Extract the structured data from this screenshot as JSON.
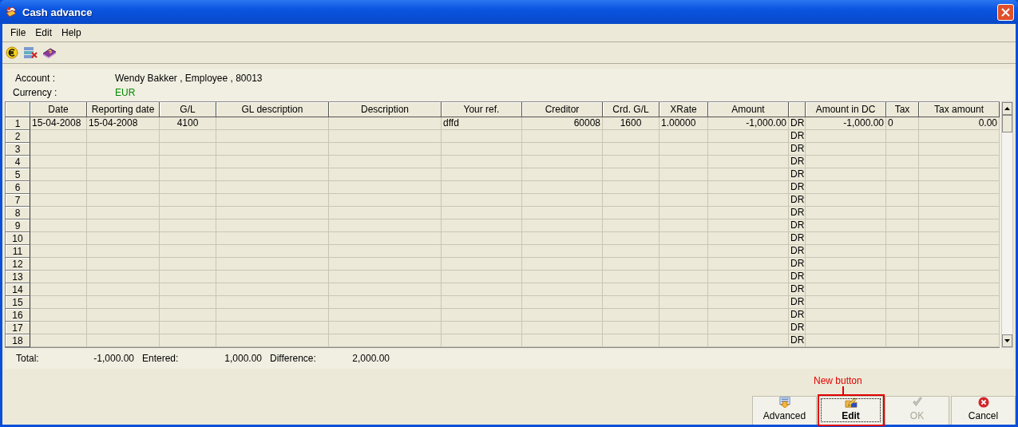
{
  "window": {
    "title": "Cash advance"
  },
  "menu": [
    "File",
    "Edit",
    "Help"
  ],
  "header": {
    "account_label": "Account :",
    "account_value": "Wendy Bakker , Employee , 80013",
    "currency_label": "Currency :",
    "currency_value": "EUR"
  },
  "table": {
    "columns": [
      "Date",
      "Reporting date",
      "G/L",
      "GL description",
      "Description",
      "Your ref.",
      "Creditor",
      "Crd. G/L",
      "XRate",
      "Amount",
      "",
      "Amount in DC",
      "Tax",
      "Tax amount"
    ],
    "rows": [
      {
        "number": "1",
        "cells": [
          "15-04-2008",
          "15-04-2008",
          "4100",
          null,
          null,
          "dffd",
          "60008",
          "1600",
          "1.00000",
          "-1,000.00",
          "DR",
          "-1,000.00",
          "0",
          "0.00"
        ]
      },
      {
        "number": "2",
        "cells": [
          null,
          null,
          null,
          null,
          null,
          null,
          null,
          null,
          null,
          null,
          "DR",
          null,
          null,
          null
        ]
      },
      {
        "number": "3",
        "cells": [
          null,
          null,
          null,
          null,
          null,
          null,
          null,
          null,
          null,
          null,
          "DR",
          null,
          null,
          null
        ]
      },
      {
        "number": "4",
        "cells": [
          null,
          null,
          null,
          null,
          null,
          null,
          null,
          null,
          null,
          null,
          "DR",
          null,
          null,
          null
        ]
      },
      {
        "number": "5",
        "cells": [
          null,
          null,
          null,
          null,
          null,
          null,
          null,
          null,
          null,
          null,
          "DR",
          null,
          null,
          null
        ]
      },
      {
        "number": "6",
        "cells": [
          null,
          null,
          null,
          null,
          null,
          null,
          null,
          null,
          null,
          null,
          "DR",
          null,
          null,
          null
        ]
      },
      {
        "number": "7",
        "cells": [
          null,
          null,
          null,
          null,
          null,
          null,
          null,
          null,
          null,
          null,
          "DR",
          null,
          null,
          null
        ]
      },
      {
        "number": "8",
        "cells": [
          null,
          null,
          null,
          null,
          null,
          null,
          null,
          null,
          null,
          null,
          "DR",
          null,
          null,
          null
        ]
      },
      {
        "number": "9",
        "cells": [
          null,
          null,
          null,
          null,
          null,
          null,
          null,
          null,
          null,
          null,
          "DR",
          null,
          null,
          null
        ]
      },
      {
        "number": "10",
        "cells": [
          null,
          null,
          null,
          null,
          null,
          null,
          null,
          null,
          null,
          null,
          "DR",
          null,
          null,
          null
        ]
      },
      {
        "number": "11",
        "cells": [
          null,
          null,
          null,
          null,
          null,
          null,
          null,
          null,
          null,
          null,
          "DR",
          null,
          null,
          null
        ]
      },
      {
        "number": "12",
        "cells": [
          null,
          null,
          null,
          null,
          null,
          null,
          null,
          null,
          null,
          null,
          "DR",
          null,
          null,
          null
        ]
      },
      {
        "number": "13",
        "cells": [
          null,
          null,
          null,
          null,
          null,
          null,
          null,
          null,
          null,
          null,
          "DR",
          null,
          null,
          null
        ]
      },
      {
        "number": "14",
        "cells": [
          null,
          null,
          null,
          null,
          null,
          null,
          null,
          null,
          null,
          null,
          "DR",
          null,
          null,
          null
        ]
      },
      {
        "number": "15",
        "cells": [
          null,
          null,
          null,
          null,
          null,
          null,
          null,
          null,
          null,
          null,
          "DR",
          null,
          null,
          null
        ]
      },
      {
        "number": "16",
        "cells": [
          null,
          null,
          null,
          null,
          null,
          null,
          null,
          null,
          null,
          null,
          "DR",
          null,
          null,
          null
        ]
      },
      {
        "number": "17",
        "cells": [
          null,
          null,
          null,
          null,
          null,
          null,
          null,
          null,
          null,
          null,
          "DR",
          null,
          null,
          null
        ]
      },
      {
        "number": "18",
        "cells": [
          null,
          null,
          null,
          null,
          null,
          null,
          null,
          null,
          null,
          null,
          "DR",
          null,
          null,
          null
        ]
      }
    ]
  },
  "totals": [
    {
      "label": "Total:",
      "value": "-1,000.00"
    },
    {
      "label": "Entered:",
      "value": "1,000.00"
    },
    {
      "label": "Difference:",
      "value": "2,000.00"
    }
  ],
  "buttons": [
    {
      "kind": "advanced",
      "label": "Advanced",
      "disabled": false,
      "focused": false
    },
    {
      "kind": "edit",
      "label": "Edit",
      "disabled": false,
      "focused": true,
      "annotation": "New button"
    },
    {
      "kind": "ok",
      "label": "OK",
      "disabled": true,
      "focused": false
    },
    {
      "kind": "cancel",
      "label": "Cancel",
      "disabled": false,
      "focused": false
    }
  ]
}
